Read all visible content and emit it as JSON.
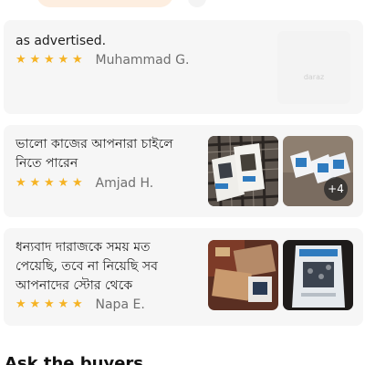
{
  "reviews": [
    {
      "text": "as advertised.",
      "rating": 5,
      "stars": [
        "★",
        "★",
        "★",
        "★",
        "★"
      ],
      "reviewer": "Muhammad G.",
      "placeholder_label": "daraz",
      "images": []
    },
    {
      "text": "ভালো কাজের আপনারা চাইলে নিতে পারেন",
      "rating": 5,
      "stars": [
        "★",
        "★",
        "★",
        "★",
        "★"
      ],
      "reviewer": "Amjad H.",
      "images": [
        "seed-packets-on-plaid-cloth-photo",
        "seed-packets-on-table-photo"
      ],
      "more_count": "+4"
    },
    {
      "text": "ধন্যবাদ দারাজকে সময় মত পেয়েছি, তবে না নিয়েছি সব আপনাদের স্টোর থেকে",
      "rating": 5,
      "stars": [
        "★",
        "★",
        "★",
        "★",
        "★"
      ],
      "reviewer": "Napa E.",
      "images": [
        "package-contents-photo",
        "seed-packet-in-hand-photo"
      ]
    }
  ],
  "next_section_title": "Ask the buyers",
  "colors": {
    "star": "#f5b324",
    "card_background": "#f6f6f6",
    "reviewer_text": "#6f6f6f",
    "chip": "#fdeee0"
  }
}
